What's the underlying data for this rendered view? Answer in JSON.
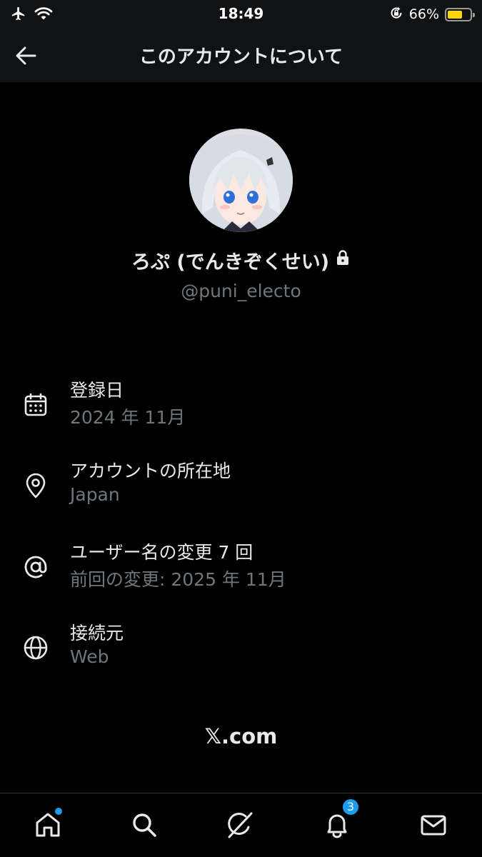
{
  "status_bar": {
    "time": "18:49",
    "battery_percent": "66%",
    "battery_level": 0.66,
    "battery_color": "#ffd60a",
    "icons": [
      "airplane-icon",
      "wifi-icon",
      "orientation-lock-icon",
      "battery-icon"
    ]
  },
  "header": {
    "title": "このアカウントについて",
    "back_icon": "back-arrow-icon"
  },
  "profile": {
    "display_name": "ろぷ (でんきぞくせい)",
    "lock_icon": "lock-icon",
    "handle": "@puni_electo"
  },
  "info": {
    "joined": {
      "icon": "calendar-icon",
      "title": "登録日",
      "value": "2024 年 11月"
    },
    "location": {
      "icon": "location-pin-icon",
      "title": "アカウントの所在地",
      "value": "Japan"
    },
    "username_changes": {
      "icon": "at-sign-icon",
      "title": "ユーザー名の変更 7 回",
      "value": "前回の変更: 2025 年 11月"
    },
    "connected_via": {
      "icon": "globe-icon",
      "title": "接続元",
      "value": "Web"
    }
  },
  "footer_link": "𝕏.com",
  "tab_bar": {
    "items": [
      {
        "icon": "home-icon",
        "has_dot": true
      },
      {
        "icon": "search-icon"
      },
      {
        "icon": "grok-icon"
      },
      {
        "icon": "bell-icon",
        "badge": "3"
      },
      {
        "icon": "mail-icon"
      }
    ],
    "accent_color": "#1d9bf0"
  },
  "colors": {
    "background": "#000000",
    "header_background": "#111214",
    "primary_text": "#e7e9ea",
    "secondary_text": "#71767b"
  }
}
